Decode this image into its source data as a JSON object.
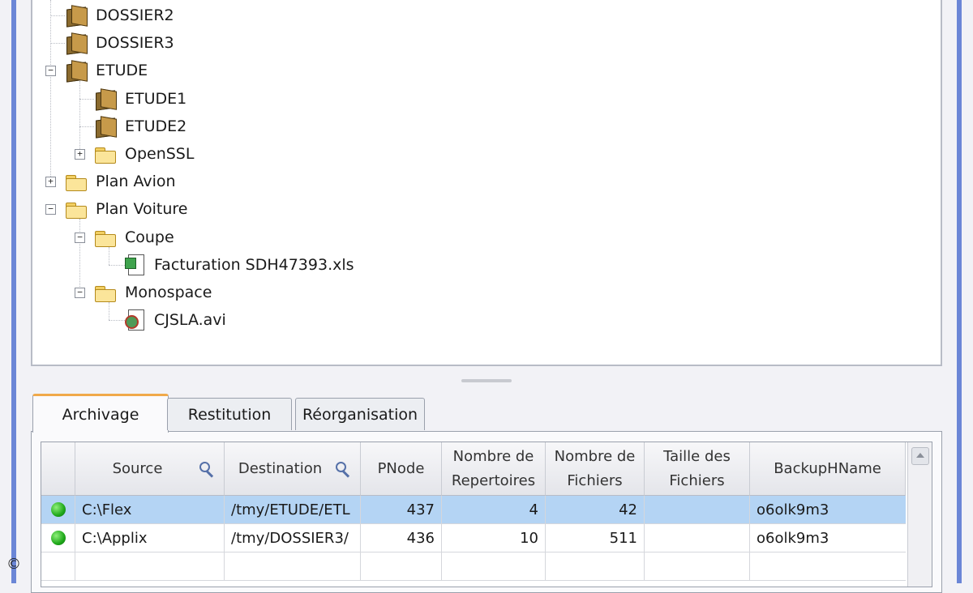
{
  "tree": {
    "items": [
      {
        "label": "DOSSIER2",
        "icon": "dark-folder-icon"
      },
      {
        "label": "DOSSIER3",
        "icon": "dark-folder-icon"
      },
      {
        "label": "ETUDE",
        "icon": "dark-folder-icon",
        "expander": "−"
      },
      {
        "label": "ETUDE1",
        "icon": "dark-folder-icon"
      },
      {
        "label": "ETUDE2",
        "icon": "dark-folder-icon"
      },
      {
        "label": "OpenSSL",
        "icon": "folder-icon",
        "expander": "+"
      },
      {
        "label": "Plan Avion",
        "icon": "folder-icon",
        "expander": "+"
      },
      {
        "label": "Plan Voiture",
        "icon": "folder-icon",
        "expander": "−"
      },
      {
        "label": "Coupe",
        "icon": "folder-icon",
        "expander": "−"
      },
      {
        "label": "Facturation SDH47393.xls",
        "icon": "xls-file-icon"
      },
      {
        "label": "Monospace",
        "icon": "folder-icon",
        "expander": "−"
      },
      {
        "label": "CJSLA.avi",
        "icon": "avi-file-icon"
      }
    ]
  },
  "tabs": {
    "archivage": "Archivage",
    "restitution": "Restitution",
    "reorganisation": "Réorganisation"
  },
  "table": {
    "columns": {
      "source": "Source",
      "destination": "Destination",
      "pnode": "PNode",
      "nb_rep_1": "Nombre de",
      "nb_rep_2": "Repertoires",
      "nb_fic_1": "Nombre de",
      "nb_fic_2": "Fichiers",
      "taille_1": "Taille des",
      "taille_2": "Fichiers",
      "backup": "BackupHName"
    },
    "rows": [
      {
        "source": "C:\\Flex",
        "destination": "/tmy/ETUDE/ETL",
        "pnode": "437",
        "repertoires": "4",
        "fichiers": "42",
        "taille": "",
        "backup": "o6olk9m3",
        "status": "green",
        "selected": true
      },
      {
        "source": "C:\\Applix",
        "destination": "/tmy/DOSSIER3/",
        "pnode": "436",
        "repertoires": "10",
        "fichiers": "511",
        "taille": "",
        "backup": "o6olk9m3",
        "status": "green",
        "selected": false
      }
    ]
  },
  "colors": {
    "selection": "#b4d4f4",
    "frame": "#6b86d6",
    "active_tab_accent": "#f0a94a",
    "status_ok": "#1fa81a"
  },
  "footer": {
    "copyright": "©"
  }
}
